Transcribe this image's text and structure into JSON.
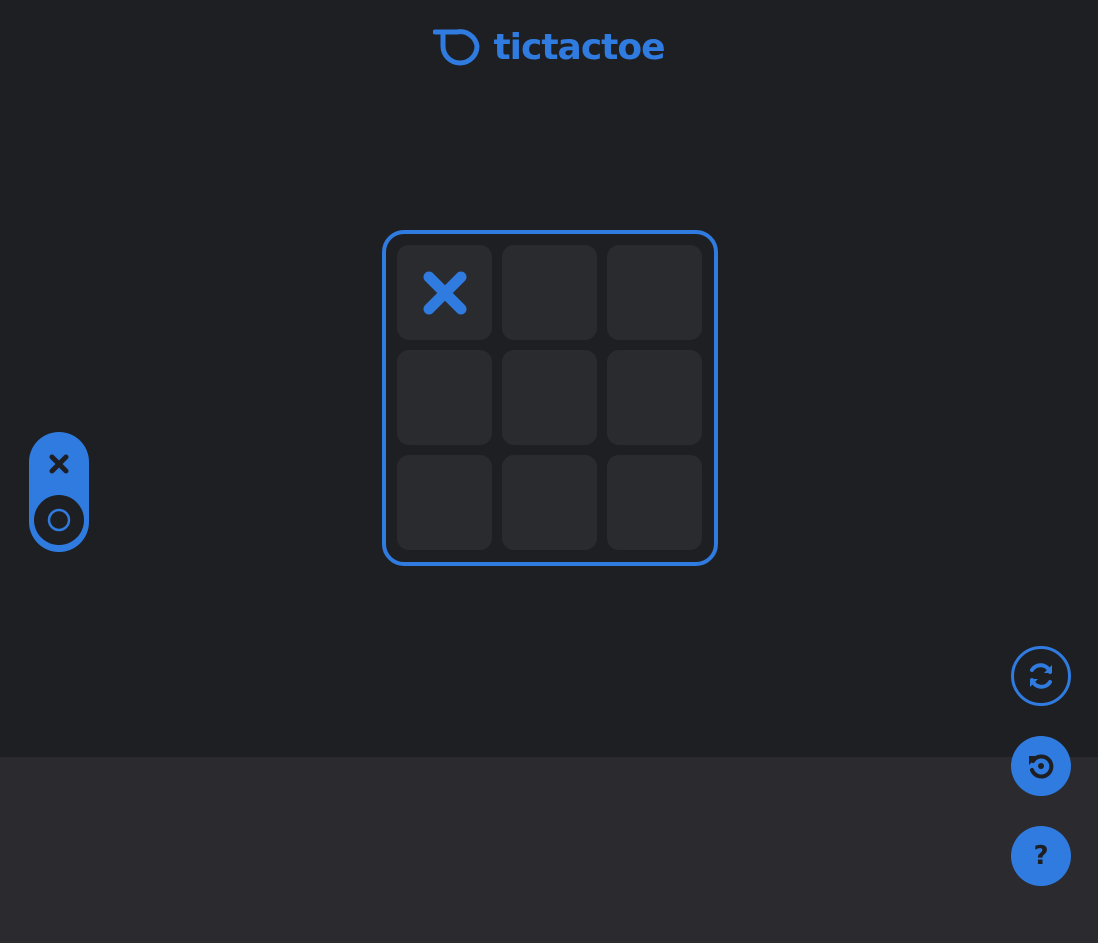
{
  "header": {
    "logo_text": "tictactoe",
    "logo_icon": "logo-mark-icon"
  },
  "colors": {
    "accent": "#2f7be0",
    "background": "#1e1f22",
    "cell": "#2a2b2e",
    "footer": "#2b2a2f"
  },
  "board": {
    "cells": [
      "X",
      "",
      "",
      "",
      "",
      "",
      "",
      "",
      ""
    ]
  },
  "player_toggle": {
    "options": [
      "X",
      "O"
    ],
    "selected": "O"
  },
  "controls": {
    "swap_icon": "swap-arrows-icon",
    "reset_icon": "reset-icon",
    "help_label": "?"
  }
}
